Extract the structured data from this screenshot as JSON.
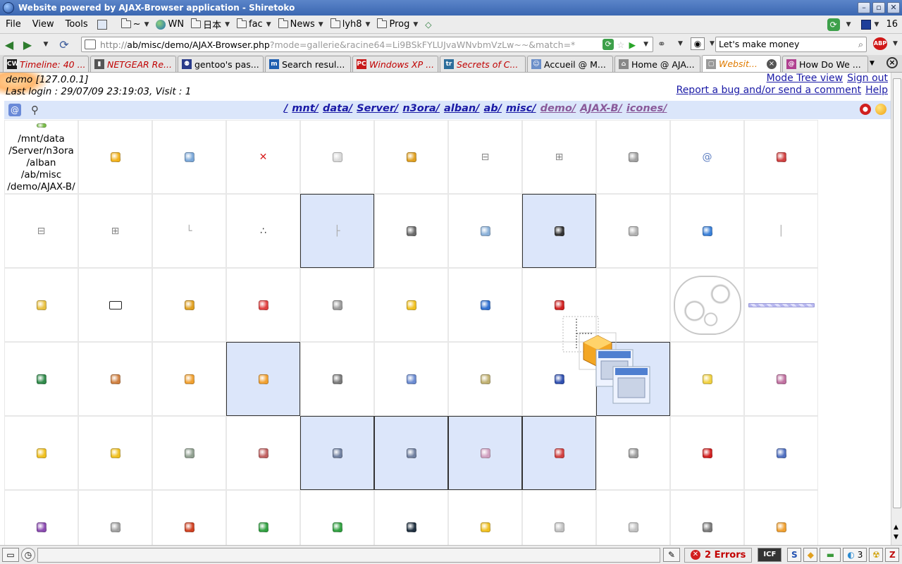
{
  "window": {
    "title": "Website powered by AJAX-Browser application - Shiretoko",
    "right_badge": "16"
  },
  "menubar": {
    "menus": [
      "File",
      "View",
      "Tools"
    ],
    "bookmarks": [
      {
        "label": "~",
        "icon": "folder-icon"
      },
      {
        "label": "WN",
        "icon": "globe-icon"
      },
      {
        "label": "日本",
        "icon": "folder-icon"
      },
      {
        "label": "fac",
        "icon": "folder-icon"
      },
      {
        "label": "News",
        "icon": "folder-icon"
      },
      {
        "label": "lyh8",
        "icon": "folder-icon"
      },
      {
        "label": "Prog",
        "icon": "folder-icon"
      }
    ]
  },
  "navbar": {
    "url_host_prefix": "http://",
    "url_host": "ab",
    "url_path": "/misc/demo/AJAX-Browser.php",
    "url_query": "?mode=gallerie&racine64=Li9BSkFYLUJvaWNvbmVzLw~~&match=*",
    "search_value": "Let's make money"
  },
  "tabs": [
    {
      "label": "Timeline: 40 ...",
      "style": "red",
      "favicon": "CW",
      "favcolor": "#1b1b1b"
    },
    {
      "label": "NETGEAR Re...",
      "style": "red",
      "favicon": "▮",
      "favcolor": "#555555"
    },
    {
      "label": "gentoo's pas...",
      "style": "normal",
      "favicon": "⚉",
      "favcolor": "#2a3b8a"
    },
    {
      "label": "Search resul...",
      "style": "normal",
      "favicon": "m",
      "favcolor": "#1f5fb0"
    },
    {
      "label": "Windows XP ...",
      "style": "red",
      "favicon": "PC",
      "favcolor": "#c81919"
    },
    {
      "label": "Secrets of C...",
      "style": "red",
      "favicon": "tr",
      "favcolor": "#2b6d9b"
    },
    {
      "label": "Accueil @ M...",
      "style": "normal",
      "favicon": "☺",
      "favcolor": "#6b8fc9"
    },
    {
      "label": "Home @ AJA...",
      "style": "normal",
      "favicon": "⌂",
      "favcolor": "#888888"
    },
    {
      "label": "Websit...",
      "style": "orange",
      "favicon": "▢",
      "favcolor": "#999999",
      "active": true
    },
    {
      "label": "How Do We ...",
      "style": "normal",
      "favicon": "@",
      "favcolor": "#b04090"
    }
  ],
  "page": {
    "user_line": "demo [127.0.0.1]",
    "login_line": "Last login : 29/07/09 23:19:03, Visit : 1",
    "links": {
      "mode_tree": "Mode Tree view",
      "sign_out": "Sign out",
      "report": "Report a bug and/or send a comment",
      "help": "Help"
    },
    "breadcrumbs": [
      "/",
      "mnt/",
      "data/",
      "Server/",
      "n3ora/",
      "alban/",
      "ab/",
      "misc/",
      "demo/",
      "AJAX-B/",
      "icones/"
    ],
    "path_cell_text": [
      "/mnt/data",
      "/Server/n3ora",
      "/alban",
      "/ab/misc",
      "/demo/AJAX-B/"
    ]
  },
  "grid": {
    "cells": [
      {
        "icon": "folder-up-icon",
        "color": "#7cc04a",
        "type": "path"
      },
      {
        "icon": "sun-ball-icon",
        "color": "#f2b21c"
      },
      {
        "icon": "desktop-icon",
        "color": "#7aa7d8"
      },
      {
        "icon": "red-cross-icon",
        "color": "#d82020",
        "glyph": "✕"
      },
      {
        "icon": "blank-page-icon",
        "color": "#d8d8d8"
      },
      {
        "icon": "scissors-icon",
        "color": "#e0a020"
      },
      {
        "icon": "expand-minus-icon",
        "color": "#888888",
        "glyph": "⊟"
      },
      {
        "icon": "expand-plus-icon",
        "color": "#888888",
        "glyph": "⊞"
      },
      {
        "icon": "disk-icon",
        "color": "#a0a0a0"
      },
      {
        "icon": "mail-at-icon",
        "color": "#5a7cc0",
        "glyph": "@"
      },
      {
        "icon": "pencil-note-icon",
        "color": "#d04040"
      },
      {
        "icon": "tree-minus-icon",
        "color": "#888888",
        "glyph": "⊟"
      },
      {
        "icon": "tree-plus-icon",
        "color": "#888888",
        "glyph": "⊞"
      },
      {
        "icon": "tree-corner-icon",
        "color": "#aaaaaa",
        "glyph": "└"
      },
      {
        "icon": "dots-loading-icon",
        "color": "#333333",
        "glyph": "∴"
      },
      {
        "icon": "tree-tee-icon",
        "color": "#aaaaaa",
        "glyph": "├",
        "selected": true
      },
      {
        "icon": "magnifier-icon",
        "color": "#6a6a6a"
      },
      {
        "icon": "zoom-icon",
        "color": "#8ab0d8"
      },
      {
        "icon": "spinner-icon",
        "color": "#333333",
        "selected": true
      },
      {
        "icon": "list-doc-icon",
        "color": "#b0b0b0"
      },
      {
        "icon": "globe-arrow-icon",
        "color": "#3a80d8"
      },
      {
        "icon": "tree-line-icon",
        "color": "#aaaaaa",
        "glyph": "│"
      },
      {
        "icon": "clipboard-icon",
        "color": "#e8c040"
      },
      {
        "icon": "window-frame-icon",
        "color": "#ffffff"
      },
      {
        "icon": "wrench-icon",
        "color": "#e0a020"
      },
      {
        "icon": "eraser-icon",
        "color": "#e04040"
      },
      {
        "icon": "trash-icon",
        "color": "#9a9a9a"
      },
      {
        "icon": "star-shield-icon",
        "color": "#f0c020"
      },
      {
        "icon": "globe-refresh-icon",
        "color": "#3070d0"
      },
      {
        "icon": "help-lifebuoy-icon",
        "color": "#d02020"
      },
      {
        "icon": "blank-icon",
        "color": "transparent"
      },
      {
        "icon": "bubbles-graphic-icon",
        "color": "transparent"
      },
      {
        "icon": "progress-stripe-icon",
        "color": "#b8b8f0"
      },
      {
        "icon": "film-icon",
        "color": "#2f8a4a"
      },
      {
        "icon": "palette-icon",
        "color": "#d08040"
      },
      {
        "icon": "box-package-icon",
        "color": "#f0a030"
      },
      {
        "icon": "box-package-icon",
        "color": "#f0a030",
        "selected": true
      },
      {
        "icon": "person-icon",
        "color": "#7a7a7a"
      },
      {
        "icon": "settings-doc-icon",
        "color": "#6a8ad0"
      },
      {
        "icon": "css-file-icon",
        "color": "#c0b070"
      },
      {
        "icon": "word-doc-icon",
        "color": "#3050b0"
      },
      {
        "icon": "folder-up-icon",
        "color": "#7cc04a",
        "selected": true
      },
      {
        "icon": "folder-icon",
        "color": "#f0d040"
      },
      {
        "icon": "image-file-icon",
        "color": "#c070a0"
      },
      {
        "icon": "hex-package-icon",
        "color": "#f0c020"
      },
      {
        "icon": "hex-package-icon",
        "color": "#f0c020"
      },
      {
        "icon": "image-file-icon",
        "color": "#90a090"
      },
      {
        "icon": "image-file-icon",
        "color": "#c06060"
      },
      {
        "icon": "image-file-icon",
        "color": "#7080a0",
        "selected": true
      },
      {
        "icon": "image-file-icon",
        "color": "#7080a0",
        "selected": true
      },
      {
        "icon": "text-file-icon",
        "color": "#d0a0c0",
        "selected": true
      },
      {
        "icon": "mp3-file-icon",
        "color": "#d04040",
        "selected": true
      },
      {
        "icon": "ogg-file-icon",
        "color": "#9a9a9a"
      },
      {
        "icon": "pdf-icon",
        "color": "#d02020"
      },
      {
        "icon": "drive-icon",
        "color": "#5070c0"
      },
      {
        "icon": "audio-file-icon",
        "color": "#8a4ab0"
      },
      {
        "icon": "image-file-icon",
        "color": "#a0a0a0"
      },
      {
        "icon": "powerpoint-icon",
        "color": "#d04020"
      },
      {
        "icon": "refresh-file-icon",
        "color": "#30a040"
      },
      {
        "icon": "refresh-icon",
        "color": "#30a040"
      },
      {
        "icon": "terminal-icon",
        "color": "#203040"
      },
      {
        "icon": "hex-package-icon",
        "color": "#f0c020"
      },
      {
        "icon": "text-doc-icon",
        "color": "#c0c0c0"
      },
      {
        "icon": "unknown-file-icon",
        "color": "#c0c0c0"
      },
      {
        "icon": "person-icon",
        "color": "#7a7a7a"
      },
      {
        "icon": "box-package-icon",
        "color": "#f0a030"
      }
    ]
  },
  "statusbar": {
    "errors": "2 Errors",
    "twitter_count": "3"
  }
}
